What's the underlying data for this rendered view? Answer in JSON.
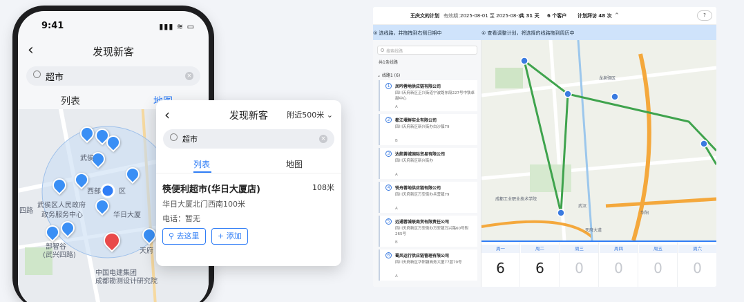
{
  "phone": {
    "time": "9:41",
    "title": "发现新客",
    "search_value": "超市",
    "tabs": [
      "列表",
      "地图"
    ],
    "map_labels": [
      "武侯",
      "西部",
      "区",
      "武侯区人民政府",
      "政务服务中心",
      "华日大厦",
      "中国电建集团",
      "成都勘测设计研究院",
      "四路",
      "部智谷",
      "(武兴四路)",
      "天府"
    ]
  },
  "card": {
    "title": "发现新客",
    "nearby": "附近500米",
    "search_value": "超市",
    "tabs": [
      "列表",
      "地图"
    ],
    "shop": {
      "name": "筷便利超市(华日大厦店)",
      "distance": "108米",
      "address": "华日大厦北门西南100米",
      "phone": "电话：暂无"
    },
    "buttons": {
      "go": "去这里",
      "add": "添加"
    }
  },
  "planner": {
    "header": {
      "owner": "王庆文的计划",
      "period_label": "有效期：",
      "period": "2025-08-01 至 2025-08-31",
      "days": "共 31 天",
      "customers": "6 个客户",
      "visits": "计划拜访 48 次"
    },
    "steps": [
      "③ 选线路，并拖拽到右侧日期中",
      "④ 查看调整计划，将选择的线路拖到周历中"
    ],
    "search_placeholder": "搜索线路",
    "count": "共1条线路",
    "group": "线路1 (6)",
    "items": [
      {
        "num": "1",
        "name": "凤吟蓉地供应链有限公司",
        "address": "四川天府新区正兴街道宁波路东段227号中铁卓越中心",
        "class": "A"
      },
      {
        "num": "2",
        "name": "都江堰鲜实业有限公司",
        "address": "四川天府新区新兴街办白沙镇79",
        "class": "B"
      },
      {
        "num": "3",
        "name": "达航蓉城国际贸易有限公司",
        "address": "四川天府新区新兴街办",
        "class": "A"
      },
      {
        "num": "4",
        "name": "锐舟蓉地供应链有限公司",
        "address": "四川天府新区万安街办兵营镇79",
        "class": "A"
      },
      {
        "num": "5",
        "name": "远通蓉城联商贸有限责任公司",
        "address": "四川天府新区万安街办万安镇万兴路60号附265号",
        "class": "B"
      },
      {
        "num": "6",
        "name": "蜀风运行供应链管理有限公司",
        "address": "四川天府新区华阳镇商务大厦77层79号",
        "class": "A"
      }
    ],
    "map_labels": [
      "龙泉驿区",
      "成都工业职业技术学院",
      "天府大道",
      "华阳",
      "武汉"
    ],
    "week": [
      {
        "day": "周一",
        "value": "6",
        "active": true
      },
      {
        "day": "周二",
        "value": "6",
        "active": true
      },
      {
        "day": "周三",
        "value": "0",
        "active": false
      },
      {
        "day": "周四",
        "value": "0",
        "active": false
      },
      {
        "day": "周五",
        "value": "0",
        "active": false
      },
      {
        "day": "周六",
        "value": "0",
        "active": false
      }
    ]
  }
}
